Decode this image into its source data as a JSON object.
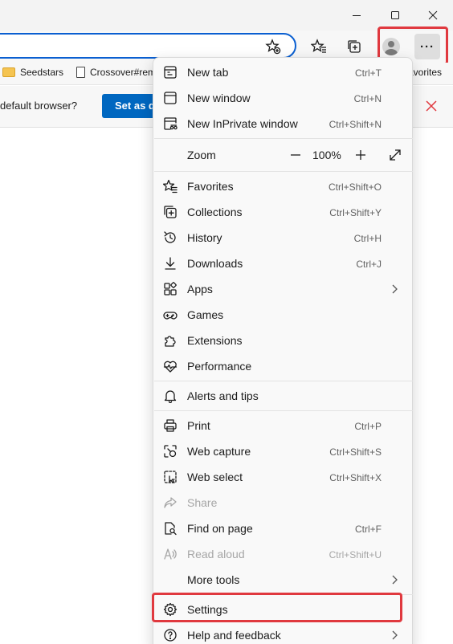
{
  "favorites_bar": {
    "items": [
      {
        "label": "Seedstars",
        "icon": "folder-icon"
      },
      {
        "label": "Crossover#rem",
        "icon": "page-icon"
      },
      {
        "label": "avorites",
        "icon": "none"
      }
    ]
  },
  "infobar": {
    "message": "default browser?",
    "set_default_label": "Set as de"
  },
  "menu": {
    "zoom": {
      "label": "Zoom",
      "value": "100%"
    },
    "items": [
      {
        "label": "New tab",
        "shortcut": "Ctrl+T",
        "icon": "new-tab-icon"
      },
      {
        "label": "New window",
        "shortcut": "Ctrl+N",
        "icon": "new-window-icon"
      },
      {
        "label": "New InPrivate window",
        "shortcut": "Ctrl+Shift+N",
        "icon": "inprivate-icon"
      },
      {
        "label": "Favorites",
        "shortcut": "Ctrl+Shift+O",
        "icon": "favorites-icon"
      },
      {
        "label": "Collections",
        "shortcut": "Ctrl+Shift+Y",
        "icon": "collections-icon"
      },
      {
        "label": "History",
        "shortcut": "Ctrl+H",
        "icon": "history-icon"
      },
      {
        "label": "Downloads",
        "shortcut": "Ctrl+J",
        "icon": "download-icon"
      },
      {
        "label": "Apps",
        "shortcut": "",
        "icon": "apps-icon",
        "submenu": true
      },
      {
        "label": "Games",
        "shortcut": "",
        "icon": "games-icon"
      },
      {
        "label": "Extensions",
        "shortcut": "",
        "icon": "extensions-icon"
      },
      {
        "label": "Performance",
        "shortcut": "",
        "icon": "performance-icon"
      },
      {
        "label": "Alerts and tips",
        "shortcut": "",
        "icon": "bell-icon"
      },
      {
        "label": "Print",
        "shortcut": "Ctrl+P",
        "icon": "print-icon"
      },
      {
        "label": "Web capture",
        "shortcut": "Ctrl+Shift+S",
        "icon": "web-capture-icon"
      },
      {
        "label": "Web select",
        "shortcut": "Ctrl+Shift+X",
        "icon": "web-select-icon"
      },
      {
        "label": "Share",
        "shortcut": "",
        "icon": "share-icon",
        "disabled": true
      },
      {
        "label": "Find on page",
        "shortcut": "Ctrl+F",
        "icon": "find-icon"
      },
      {
        "label": "Read aloud",
        "shortcut": "Ctrl+Shift+U",
        "icon": "read-aloud-icon",
        "disabled": true
      },
      {
        "label": "More tools",
        "shortcut": "",
        "icon": "none",
        "submenu": true
      },
      {
        "label": "Settings",
        "shortcut": "",
        "icon": "gear-icon"
      },
      {
        "label": "Help and feedback",
        "shortcut": "",
        "icon": "help-icon",
        "submenu": true
      }
    ]
  },
  "colors": {
    "accent": "#0067c0",
    "address_border": "#0a5fd1",
    "highlight": "#e0393f",
    "close_x": "#e0393f"
  }
}
